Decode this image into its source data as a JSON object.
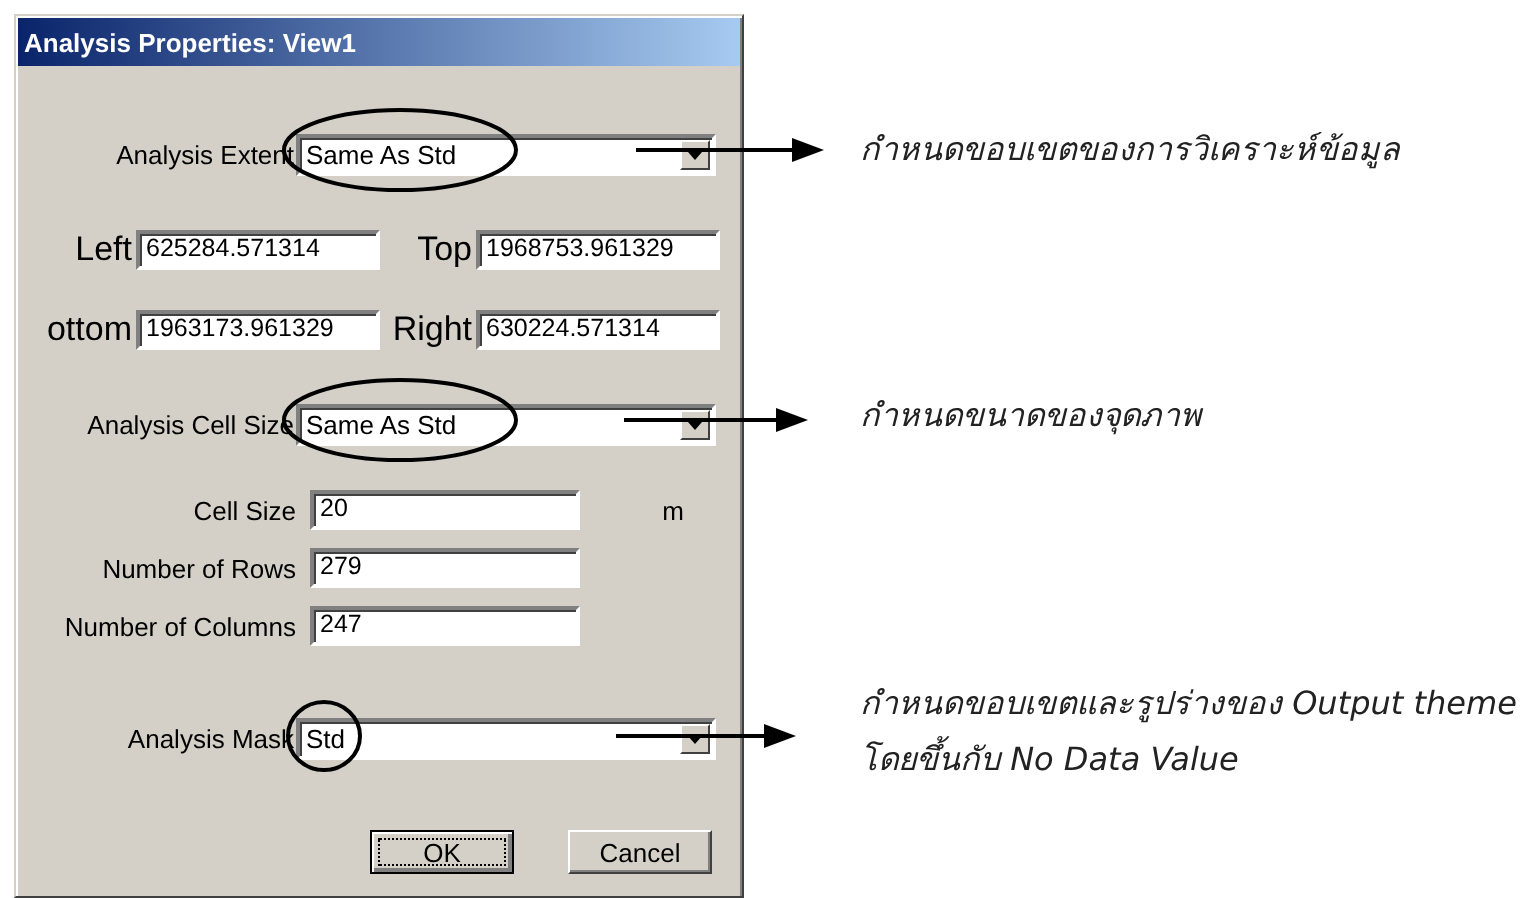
{
  "window": {
    "title": "Analysis Properties: View1"
  },
  "analysis_extent": {
    "label": "Analysis Extent",
    "value": "Same As Std"
  },
  "extent_fields": [
    {
      "label": "Left",
      "value": "625284.571314"
    },
    {
      "label": "Top",
      "value": "1968753.961329"
    },
    {
      "label": "ottom",
      "value": "1963173.961329"
    },
    {
      "label": "Right",
      "value": "630224.571314"
    }
  ],
  "analysis_cell_size": {
    "label": "Analysis Cell Size",
    "value": "Same As Std"
  },
  "cell_fields": [
    {
      "label": "Cell Size",
      "value": "20",
      "unit": "m"
    },
    {
      "label": "Number of Rows",
      "value": "279"
    },
    {
      "label": "Number of Columns",
      "value": "247"
    }
  ],
  "analysis_mask": {
    "label": "Analysis Mask",
    "value": "Std"
  },
  "buttons": [
    {
      "label": "OK",
      "focused": true
    },
    {
      "label": "Cancel",
      "focused": false
    }
  ],
  "annotations": [
    {
      "lines": [
        "กำหนดขอบเขตของการวิเคราะห์ข้อมูล"
      ]
    },
    {
      "lines": [
        "กำหนดขนาดของจุดภาพ"
      ]
    },
    {
      "lines": [
        "กำหนดขอบเขตและรูปร่างของ Output theme",
        "โดยขึ้นกับ No Data Value"
      ]
    }
  ]
}
